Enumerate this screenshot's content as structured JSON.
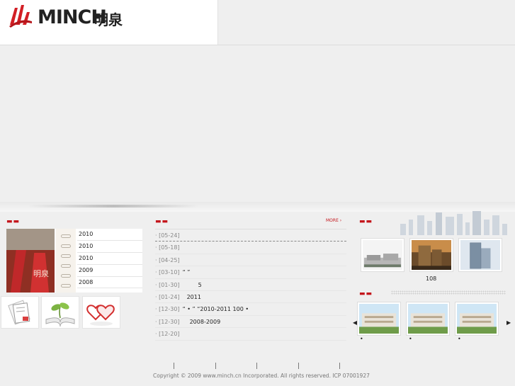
{
  "header": {
    "logo_text": "MINCH",
    "logo_cn": "明泉"
  },
  "brochure": {
    "cover_text": "明泉",
    "years": [
      "2010",
      "2010",
      "2010",
      "2009",
      "2008"
    ]
  },
  "icons": [
    "document-icon",
    "book-sprout-icon",
    "hearts-icon"
  ],
  "news": {
    "more_label": "MORE ›",
    "items": [
      {
        "date": "· [05-24]",
        "text": ""
      },
      {
        "date": "· [05-18]",
        "text": ""
      },
      {
        "date": "· [04-25]",
        "text": ""
      },
      {
        "date": "· [03-10]",
        "text": "“ ”"
      },
      {
        "date": "· [01-30]",
        "text": "5"
      },
      {
        "date": "· [01-24]",
        "text": "2011"
      },
      {
        "date": "· [12-30]",
        "text": "“ • ” “2010-2011   100        •"
      },
      {
        "date": "· [12-30]",
        "text": "2008-2009"
      },
      {
        "date": "· [12-20]",
        "text": ""
      }
    ]
  },
  "projects": {
    "caption": "108"
  },
  "footer": {
    "separators": [
      "|",
      "|",
      "|",
      "|",
      "|"
    ],
    "copyright": "Copyright © 2009 www.minch.cn Incorporated. All rights reserved.   ICP  07001927"
  },
  "colors": {
    "accent": "#c4161c",
    "background": "#efefef"
  }
}
